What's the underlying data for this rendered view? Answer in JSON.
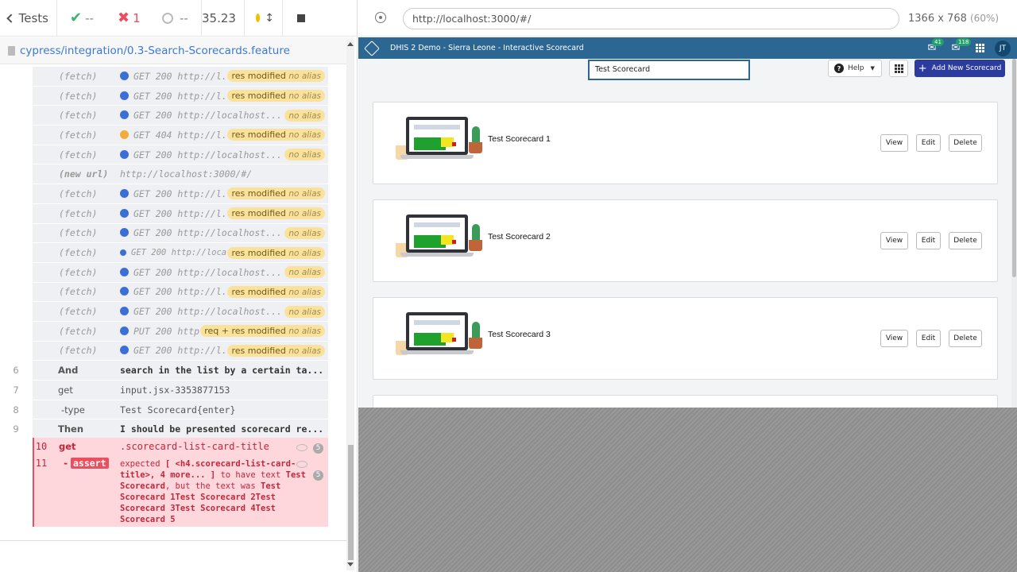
{
  "reporter": {
    "tests_label": "Tests",
    "passed": "--",
    "failed": "1",
    "pending": "--",
    "duration": "35.23",
    "spec_file": "cypress/integration/0.3-Search-Scorecards.feature"
  },
  "commands": [
    {
      "name": "(fetch)",
      "dot": "blue",
      "msg": "GET 200 http://l...",
      "badge": "res modified",
      "alias": "no alias"
    },
    {
      "name": "(fetch)",
      "dot": "blue",
      "msg": "GET 200 http://l...",
      "badge": "res modified",
      "alias": "no alias"
    },
    {
      "name": "(fetch)",
      "dot": "blue",
      "msg": "GET 200 http://localhost...",
      "badge": "",
      "alias": "no alias"
    },
    {
      "name": "(fetch)",
      "dot": "orange",
      "msg": "GET 404 http://l...",
      "badge": "res modified",
      "alias": "no alias"
    },
    {
      "name": "(fetch)",
      "dot": "blue",
      "msg": "GET 200 http://localhost...",
      "badge": "",
      "alias": "no alias"
    },
    {
      "name": "(new url)",
      "dot": "",
      "msg": "http://localhost:3000/#/",
      "badge": "",
      "alias": ""
    },
    {
      "name": "(fetch)",
      "dot": "blue",
      "msg": "GET 200 http://l...",
      "badge": "res modified",
      "alias": "no alias"
    },
    {
      "name": "(fetch)",
      "dot": "blue",
      "msg": "GET 200 http://l...",
      "badge": "res modified",
      "alias": "no alias"
    },
    {
      "name": "(fetch)",
      "dot": "blue",
      "msg": "GET 200 http://localhost...",
      "badge": "",
      "alias": "no alias"
    },
    {
      "name": "(fetch)",
      "dot": "blue",
      "msg": "GET 200 http://loca...",
      "badge": "res modified",
      "alias": "no alias"
    },
    {
      "name": "(fetch)",
      "dot": "blue",
      "msg": "GET 200 http://localhost...",
      "badge": "",
      "alias": "no alias"
    },
    {
      "name": "(fetch)",
      "dot": "blue",
      "msg": "GET 200 http://l...",
      "badge": "res modified",
      "alias": "no alias"
    },
    {
      "name": "(fetch)",
      "dot": "blue",
      "msg": "GET 200 http://localhost...",
      "badge": "",
      "alias": "no alias"
    },
    {
      "name": "(fetch)",
      "dot": "blue",
      "msg": "PUT 200 http...",
      "badge": "req + res modified",
      "alias": "no alias"
    },
    {
      "name": "(fetch)",
      "dot": "blue",
      "msg": "GET 200 http://l...",
      "badge": "res modified",
      "alias": "no alias"
    }
  ],
  "steps": [
    {
      "num": "6",
      "name": "And",
      "msg": "search in the list by a certain ta...",
      "bold": true
    },
    {
      "num": "7",
      "name": "get",
      "msg": "input.jsx-3353877153",
      "bold": false
    },
    {
      "num": "8",
      "name": "-type",
      "msg": "Test Scorecard{enter}",
      "bold": false
    },
    {
      "num": "9",
      "name": "Then",
      "msg": "I should be presented scorecard re...",
      "bold": true
    }
  ],
  "error": {
    "get_num": "10",
    "get_name": "get",
    "get_msg": ".scorecard-list-card-title",
    "get_count": "5",
    "assert_num": "11",
    "assert_prefix": "-",
    "assert_label": "assert",
    "assert_count": "5",
    "m1": "expected",
    "m2": "[ <h4.scorecard-list-card-title>, 4 more... ]",
    "m3": "to have text",
    "m4": "Test Scorecard",
    "m5": ", but the text was",
    "m6": "Test Scorecard 1Test Scorecard 2Test Scorecard 3Test Scorecard 4Test Scorecard 5"
  },
  "aut": {
    "url": "http://localhost:3000/#/",
    "viewport": "1366 x 768",
    "scale": "(60%)"
  },
  "app": {
    "title": "DHIS 2 Demo - Sierra Leone - Interactive Scorecard",
    "messages_badge": "41",
    "interpretations_badge": "118",
    "avatar": "JT",
    "search_value": "Test Scorecard",
    "help_label": "Help",
    "add_label": "Add New Scorecard",
    "cards": [
      {
        "title": "Test Scorecard 1",
        "view": "View",
        "edit": "Edit",
        "delete": "Delete"
      },
      {
        "title": "Test Scorecard 2",
        "view": "View",
        "edit": "Edit",
        "delete": "Delete"
      },
      {
        "title": "Test Scorecard 3",
        "view": "View",
        "edit": "Edit",
        "delete": "Delete"
      }
    ]
  },
  "colors": {
    "accent": "#2c6693",
    "primary_btn": "#2b3b9e",
    "fail": "#e94f5f",
    "pass": "#3cb371"
  }
}
